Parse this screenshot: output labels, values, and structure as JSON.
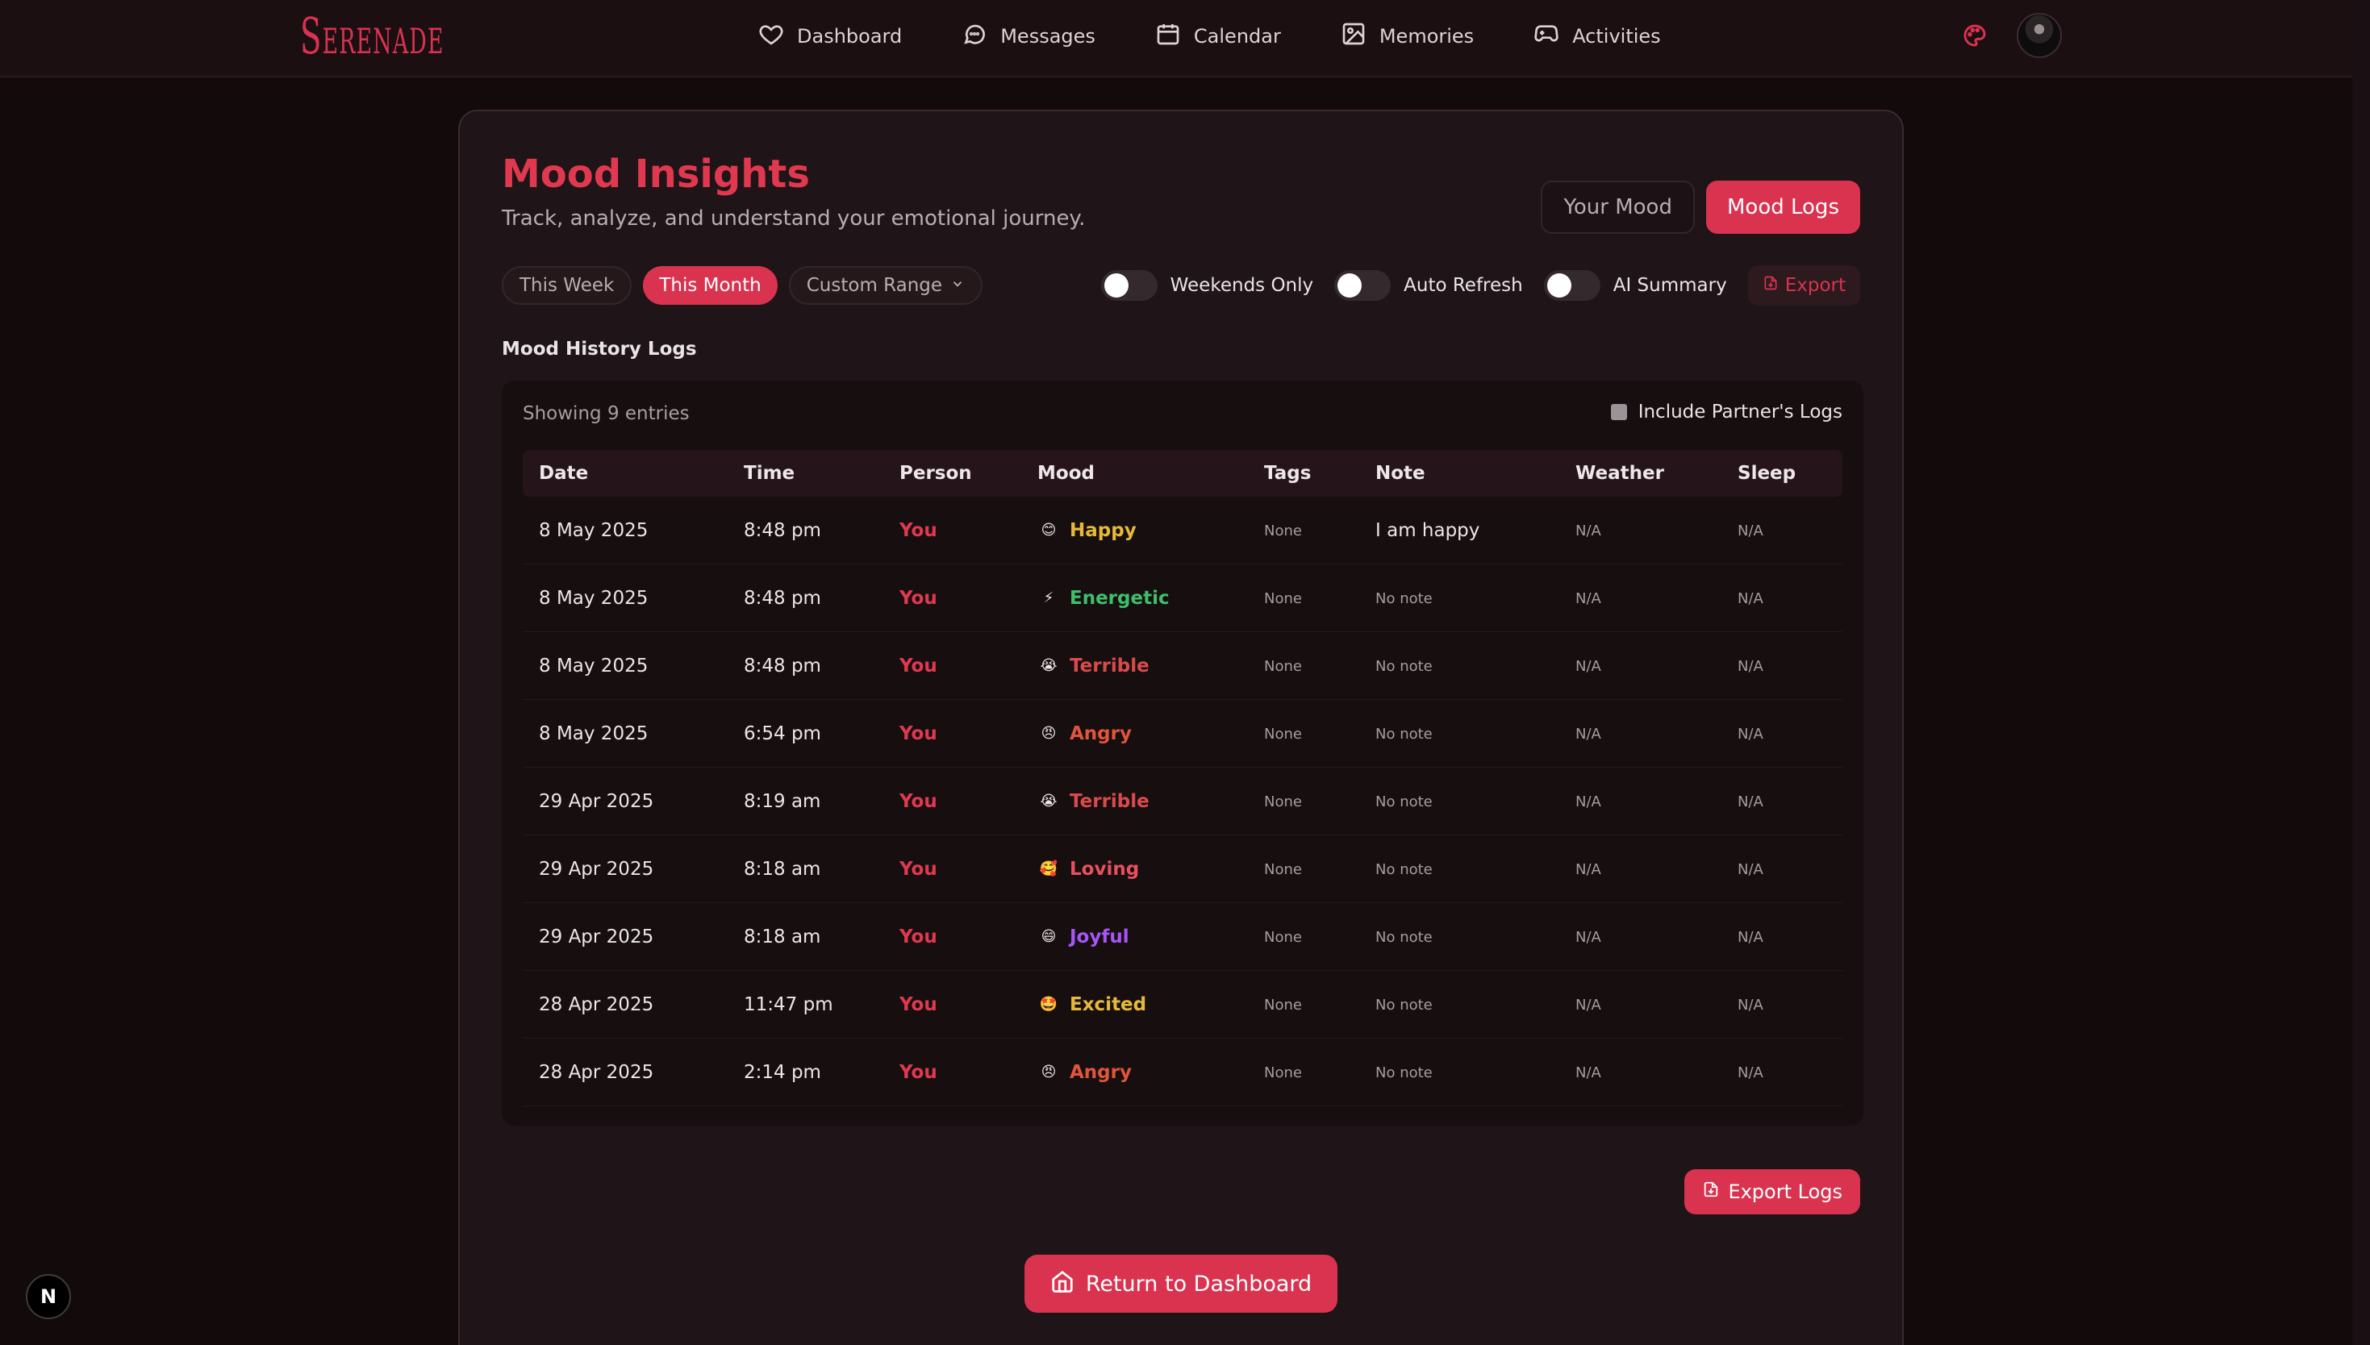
{
  "app": {
    "logo": "Serenade"
  },
  "nav": {
    "items": [
      {
        "label": "Dashboard",
        "icon": "heart-icon"
      },
      {
        "label": "Messages",
        "icon": "message-icon"
      },
      {
        "label": "Calendar",
        "icon": "calendar-icon"
      },
      {
        "label": "Memories",
        "icon": "image-icon"
      },
      {
        "label": "Activities",
        "icon": "gamepad-icon"
      }
    ],
    "right_icons": [
      "palette-icon",
      "avatar"
    ]
  },
  "header": {
    "title": "Mood Insights",
    "subtitle": "Track, analyze, and understand your emotional journey.",
    "tabs": [
      {
        "label": "Your Mood",
        "active": false
      },
      {
        "label": "Mood Logs",
        "active": true
      }
    ]
  },
  "filters": {
    "ranges": [
      {
        "label": "This Week",
        "active": false
      },
      {
        "label": "This Month",
        "active": true
      },
      {
        "label": "Custom Range",
        "active": false
      }
    ],
    "toggles": [
      {
        "label": "Weekends Only",
        "on": false
      },
      {
        "label": "Auto Refresh",
        "on": false
      },
      {
        "label": "AI Summary",
        "on": false
      }
    ],
    "export_label": "Export"
  },
  "logs": {
    "section_title": "Mood History Logs",
    "showing": "Showing 9 entries",
    "partner_label": "Include Partner's Logs",
    "partner_checked": false,
    "columns": [
      "Date",
      "Time",
      "Person",
      "Mood",
      "Tags",
      "Note",
      "Weather",
      "Sleep"
    ],
    "rows": [
      {
        "date": "8 May 2025",
        "time": "8:48 pm",
        "person": "You",
        "emoji": "😊",
        "mood": "Happy",
        "mood_color": "#e6b93a",
        "tags": "None",
        "note": "I am happy",
        "weather": "N/A",
        "sleep": "N/A"
      },
      {
        "date": "8 May 2025",
        "time": "8:48 pm",
        "person": "You",
        "emoji": "⚡",
        "mood": "Energetic",
        "mood_color": "#3fbf6a",
        "tags": "None",
        "note": "No note",
        "weather": "N/A",
        "sleep": "N/A"
      },
      {
        "date": "8 May 2025",
        "time": "8:48 pm",
        "person": "You",
        "emoji": "😭",
        "mood": "Terrible",
        "mood_color": "#d94b4b",
        "tags": "None",
        "note": "No note",
        "weather": "N/A",
        "sleep": "N/A"
      },
      {
        "date": "8 May 2025",
        "time": "6:54 pm",
        "person": "You",
        "emoji": "😠",
        "mood": "Angry",
        "mood_color": "#e0553c",
        "tags": "None",
        "note": "No note",
        "weather": "N/A",
        "sleep": "N/A"
      },
      {
        "date": "29 Apr 2025",
        "time": "8:19 am",
        "person": "You",
        "emoji": "😭",
        "mood": "Terrible",
        "mood_color": "#d94b4b",
        "tags": "None",
        "note": "No note",
        "weather": "N/A",
        "sleep": "N/A"
      },
      {
        "date": "29 Apr 2025",
        "time": "8:18 am",
        "person": "You",
        "emoji": "🥰",
        "mood": "Loving",
        "mood_color": "#e8505f",
        "tags": "None",
        "note": "No note",
        "weather": "N/A",
        "sleep": "N/A"
      },
      {
        "date": "29 Apr 2025",
        "time": "8:18 am",
        "person": "You",
        "emoji": "😄",
        "mood": "Joyful",
        "mood_color": "#a855f7",
        "tags": "None",
        "note": "No note",
        "weather": "N/A",
        "sleep": "N/A"
      },
      {
        "date": "28 Apr 2025",
        "time": "11:47 pm",
        "person": "You",
        "emoji": "🤩",
        "mood": "Excited",
        "mood_color": "#e6b93a",
        "tags": "None",
        "note": "No note",
        "weather": "N/A",
        "sleep": "N/A"
      },
      {
        "date": "28 Apr 2025",
        "time": "2:14 pm",
        "person": "You",
        "emoji": "😠",
        "mood": "Angry",
        "mood_color": "#e0553c",
        "tags": "None",
        "note": "No note",
        "weather": "N/A",
        "sleep": "N/A"
      }
    ]
  },
  "actions": {
    "export_logs": "Export Logs",
    "return": "Return to Dashboard"
  },
  "badge": "N",
  "colors": {
    "accent": "#d9334f",
    "background": "#130a0c",
    "card": "#1f1417"
  }
}
